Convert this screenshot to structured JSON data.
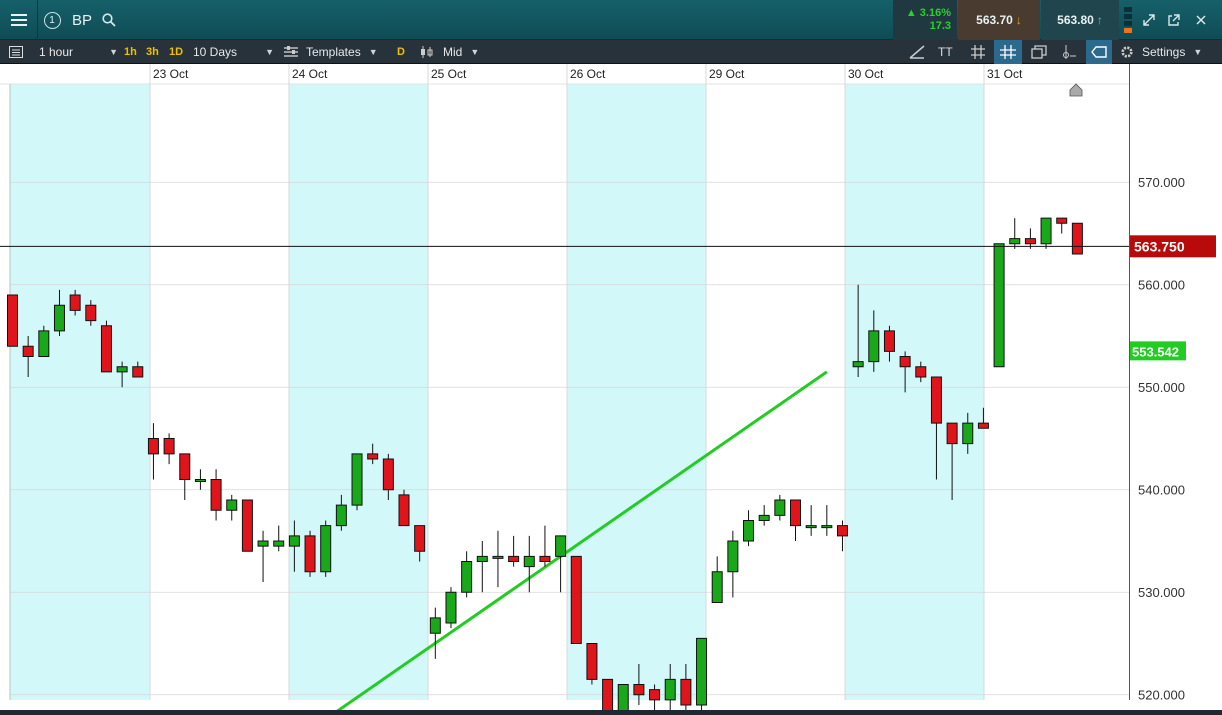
{
  "header": {
    "instrument": "BP",
    "alert_count": "1",
    "change_pct": "▲ 3.16%",
    "change_pts": "17.3",
    "sell_price": "563.70",
    "buy_price": "563.80"
  },
  "toolbar": {
    "interval": "1 hour",
    "quick_intervals": [
      "1h",
      "3h",
      "1D"
    ],
    "range": "10 Days",
    "templates": "Templates",
    "d_button": "D",
    "price_mode": "Mid",
    "tt_label": "TT",
    "settings": "Settings"
  },
  "colors": {
    "up": "#19a819",
    "down": "#e0151b",
    "shade": "#d3f8fa",
    "trendline": "#22cc22",
    "current_price_tag": "#b80a0a",
    "trend_tag": "#22cc22"
  },
  "chart_data": {
    "type": "candlestick",
    "x_labels": [
      "23 Oct",
      "24 Oct",
      "25 Oct",
      "26 Oct",
      "29 Oct",
      "30 Oct",
      "31 Oct"
    ],
    "y_ticks": [
      "570.000",
      "560.000",
      "550.000",
      "540.000",
      "530.000",
      "520.000"
    ],
    "ylim": [
      510.5,
      572.5
    ],
    "current_price": 563.75,
    "current_price_label": "563.750",
    "trendline": {
      "start": [
        18.0,
        515.5
      ],
      "end": [
        52.0,
        551.5
      ],
      "label": "553.542",
      "label_value": 553.5
    },
    "candles": [
      [
        559,
        554,
        559,
        554
      ],
      [
        554,
        553,
        555,
        551
      ],
      [
        553,
        555.5,
        556,
        553
      ],
      [
        555.5,
        558,
        559.5,
        555
      ],
      [
        559,
        557.5,
        559.5,
        557
      ],
      [
        558,
        556.5,
        558.5,
        556
      ],
      [
        556,
        551.5,
        556.5,
        551.5
      ],
      [
        551.5,
        552,
        552.5,
        550
      ],
      [
        552,
        551,
        552.5,
        551
      ],
      [
        545,
        543.5,
        546.5,
        541
      ],
      [
        545,
        543.5,
        545.5,
        542.5
      ],
      [
        543.5,
        541,
        543.5,
        539
      ],
      [
        541,
        541,
        542,
        540
      ],
      [
        541,
        538,
        542,
        537
      ],
      [
        538,
        539,
        539.5,
        537
      ],
      [
        539,
        534,
        539,
        534
      ],
      [
        534.5,
        535,
        536,
        531
      ],
      [
        534.5,
        535,
        536.5,
        534
      ],
      [
        534.5,
        535.5,
        537,
        532
      ],
      [
        535.5,
        532,
        536,
        531.5
      ],
      [
        532,
        536.5,
        537,
        531.5
      ],
      [
        536.5,
        538.5,
        539.5,
        536
      ],
      [
        538.5,
        543.5,
        543.5,
        538
      ],
      [
        543.5,
        543,
        544.5,
        542.5
      ],
      [
        543,
        540,
        543.5,
        539
      ],
      [
        539.5,
        536.5,
        540,
        536.5
      ],
      [
        536.5,
        534,
        536.5,
        533
      ],
      [
        526,
        527.5,
        528.5,
        523.5
      ],
      [
        527,
        530,
        530.5,
        526.5
      ],
      [
        530,
        533,
        534,
        529.5
      ],
      [
        533,
        533.5,
        535,
        530
      ],
      [
        533.5,
        533.5,
        536,
        530.5
      ],
      [
        533.5,
        533,
        535.5,
        532.5
      ],
      [
        532.5,
        533.5,
        535.5,
        530
      ],
      [
        533.5,
        533,
        536.5,
        532.5
      ],
      [
        533.5,
        535.5,
        535.5,
        530
      ],
      [
        533.5,
        525,
        533.5,
        525
      ],
      [
        525,
        521.5,
        525,
        521
      ],
      [
        521.5,
        518,
        521.5,
        515.5
      ],
      [
        518,
        521,
        521,
        518
      ],
      [
        521,
        520,
        523,
        519
      ],
      [
        520.5,
        519.5,
        521,
        518.5
      ],
      [
        519.5,
        521.5,
        523,
        518.5
      ],
      [
        521.5,
        519,
        523,
        518.5
      ],
      [
        519,
        525.5,
        525.5,
        518.5
      ],
      [
        529,
        532,
        533.5,
        529
      ],
      [
        532,
        535,
        536,
        529.5
      ],
      [
        535,
        537,
        538,
        534.5
      ],
      [
        537,
        537.5,
        538.5,
        536.5
      ],
      [
        537.5,
        539,
        539.5,
        537
      ],
      [
        539,
        536.5,
        539,
        535
      ],
      [
        536.5,
        536.5,
        538.5,
        535.5
      ],
      [
        536.5,
        536.5,
        538.5,
        535.5
      ],
      [
        536.5,
        535.5,
        537,
        534
      ],
      [
        552,
        552.5,
        560,
        551
      ],
      [
        552.5,
        555.5,
        557.5,
        551.5
      ],
      [
        555.5,
        553.5,
        556,
        552.5
      ],
      [
        553,
        552,
        553.5,
        549.5
      ],
      [
        552,
        551,
        552.5,
        550.5
      ],
      [
        551,
        546.5,
        551,
        541
      ],
      [
        546.5,
        544.5,
        546.5,
        539
      ],
      [
        544.5,
        546.5,
        547.5,
        543.5
      ],
      [
        546.5,
        546,
        548,
        546
      ],
      [
        552,
        564,
        564,
        552
      ],
      [
        564,
        564.5,
        566.5,
        563.5
      ],
      [
        564.5,
        564,
        565.5,
        563.5
      ],
      [
        564,
        566.5,
        566.5,
        563.5
      ],
      [
        566.5,
        566,
        566.5,
        565
      ],
      [
        566,
        563,
        566,
        563
      ]
    ]
  }
}
